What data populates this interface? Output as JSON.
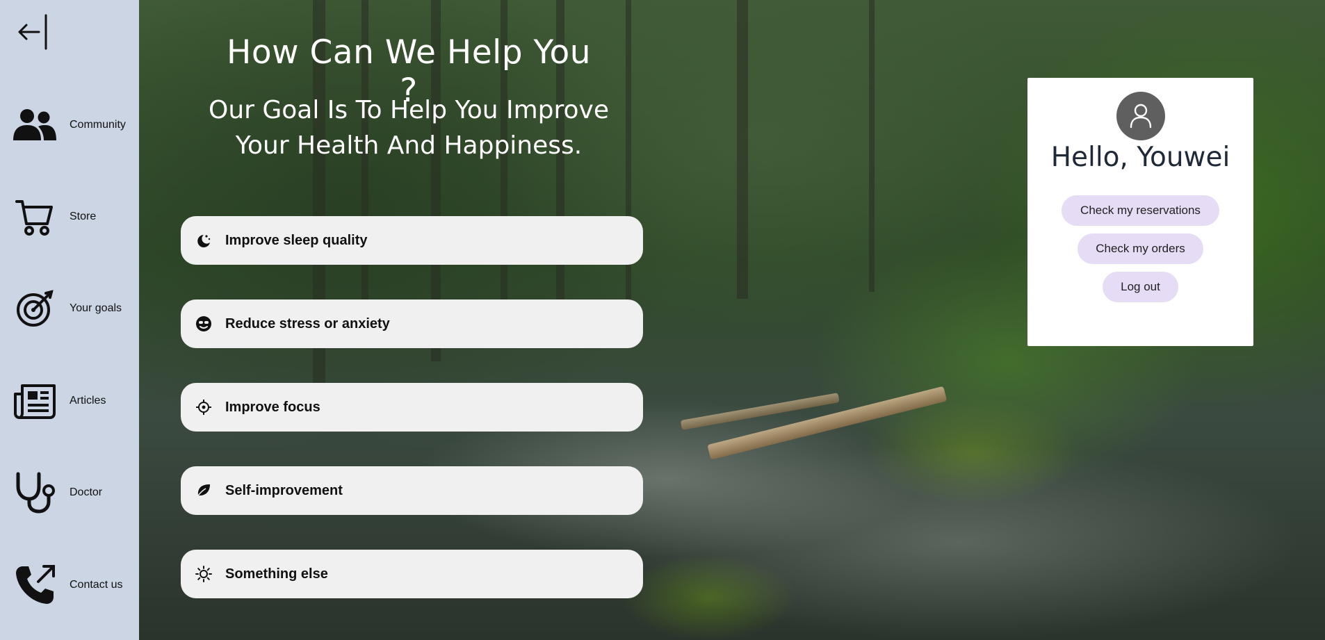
{
  "sidebar": {
    "collapse_icon": "arrow-left-bar-icon",
    "items": [
      {
        "label": "Community",
        "icon": "users-icon"
      },
      {
        "label": "Store",
        "icon": "cart-icon"
      },
      {
        "label": "Your goals",
        "icon": "target-icon"
      },
      {
        "label": "Articles",
        "icon": "newspaper-icon"
      },
      {
        "label": "Doctor",
        "icon": "stethoscope-icon"
      },
      {
        "label": "Contact us",
        "icon": "phone-outgoing-icon"
      }
    ]
  },
  "hero": {
    "title": "How Can We Help You ?",
    "subtitle_line1": "Our Goal Is To Help You Improve",
    "subtitle_line2": "Your Health And Happiness."
  },
  "options": [
    {
      "label": "Improve sleep quality",
      "icon": "moon-stars-icon"
    },
    {
      "label": "Reduce stress or anxiety",
      "icon": "sunglasses-face-icon"
    },
    {
      "label": "Improve focus",
      "icon": "crosshair-icon"
    },
    {
      "label": "Self-improvement",
      "icon": "leaf-icon"
    },
    {
      "label": "Something else",
      "icon": "sun-icon"
    }
  ],
  "user_card": {
    "avatar_icon": "user-icon",
    "greeting": "Hello, Youwei",
    "buttons": [
      "Check my reservations",
      "Check my orders",
      "Log out"
    ]
  },
  "colors": {
    "sidebar_bg": "#cbd5e3",
    "option_bg": "#f0f0f0",
    "pill_bg": "#e6dcf5",
    "avatar_bg": "#5f5f5f"
  }
}
